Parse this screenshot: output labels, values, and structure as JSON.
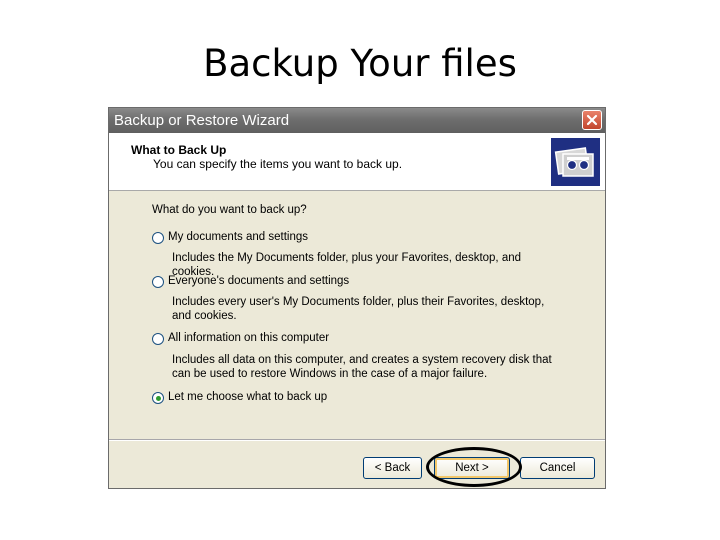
{
  "slide": {
    "title": "Backup Your files"
  },
  "window": {
    "title": "Backup or Restore Wizard"
  },
  "header": {
    "title": "What to Back Up",
    "subtitle": "You can specify the items you want to back up."
  },
  "content": {
    "question": "What do you want to back up?",
    "options": [
      {
        "label": "My documents and settings",
        "description": "Includes the My Documents folder, plus your Favorites, desktop, and cookies.",
        "selected": false
      },
      {
        "label": "Everyone's documents and settings",
        "description": "Includes every user's My Documents folder, plus their Favorites, desktop, and cookies.",
        "selected": false
      },
      {
        "label": "All information on this computer",
        "description": "Includes all data on this computer, and creates a system recovery disk that can be used to restore Windows in the case of a major failure.",
        "selected": false
      },
      {
        "label": "Let me choose what to back up",
        "description": "",
        "selected": true
      }
    ]
  },
  "buttons": {
    "back": "< Back",
    "next": "Next >",
    "cancel": "Cancel"
  },
  "icons": {
    "close": "close-icon",
    "header": "backup-tape-icon",
    "radio_selected_color": "#2e9b2e"
  },
  "colors": {
    "titlebar": "#6e6e6e",
    "window_bg": "#ece9d8",
    "header_icon_bg": "#1f2f82",
    "highlight": "#000000"
  }
}
